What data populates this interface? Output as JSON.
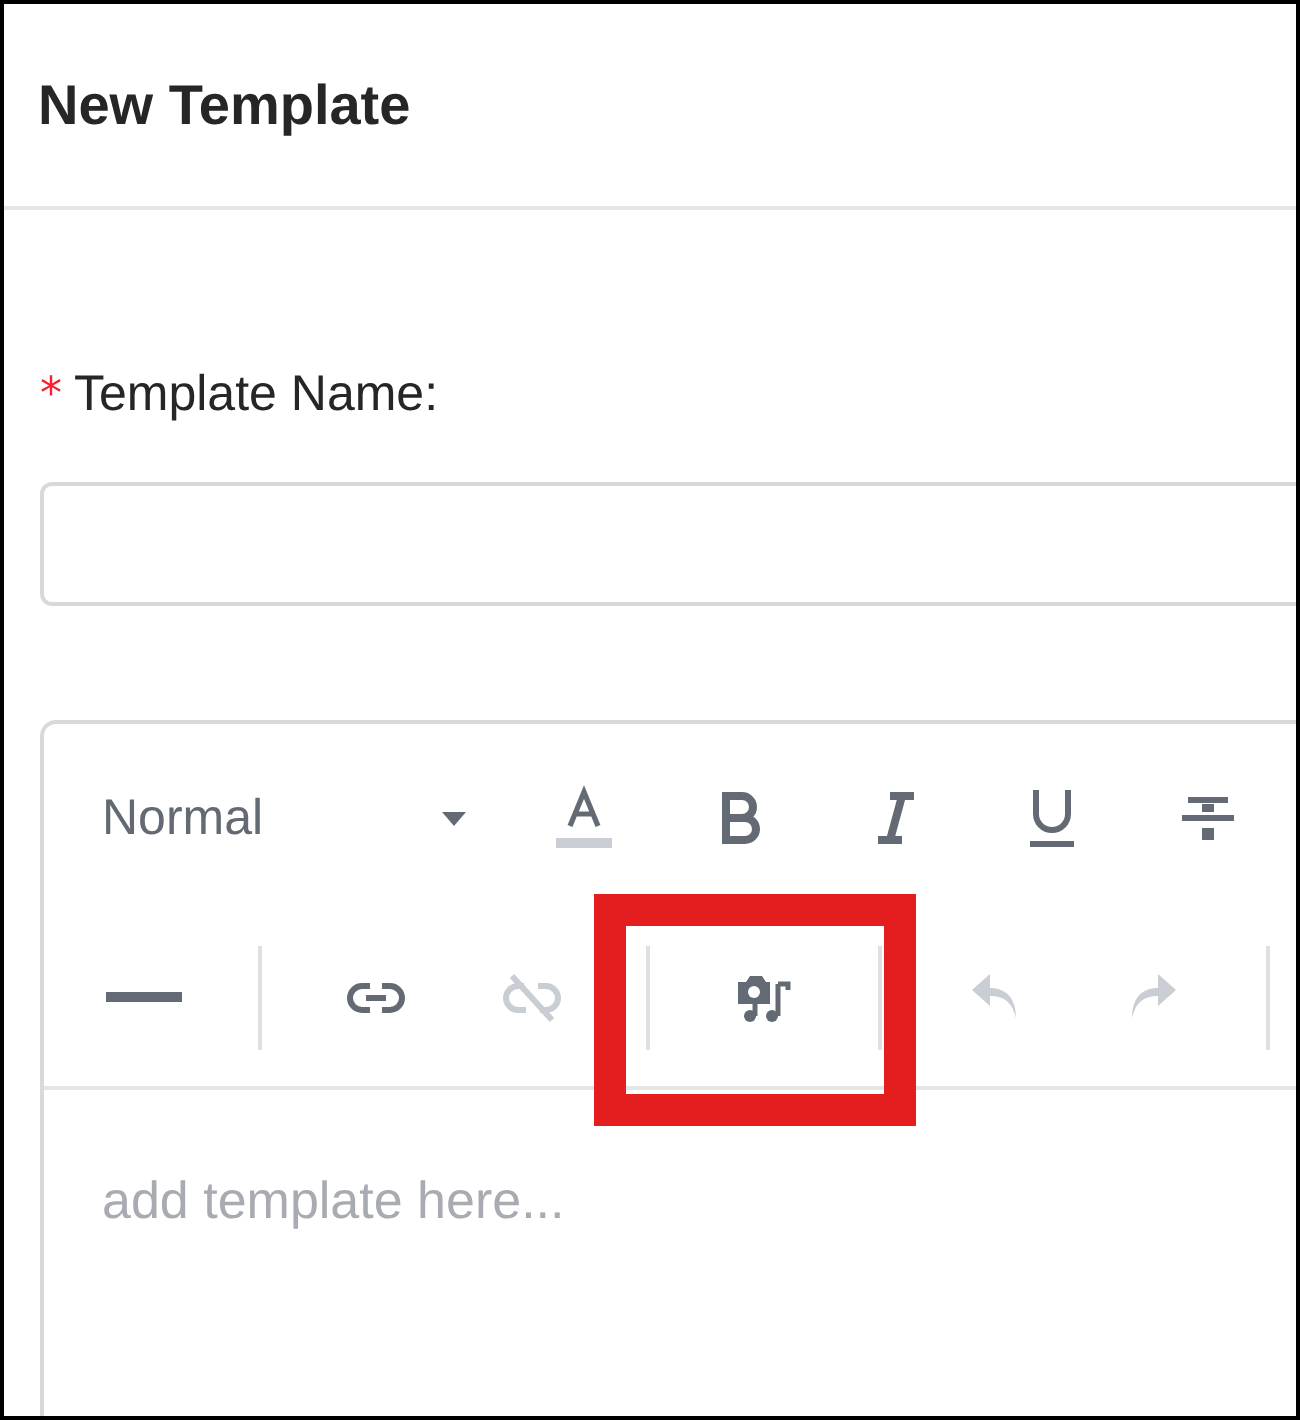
{
  "dialog": {
    "title": "New Template"
  },
  "form": {
    "field": {
      "required_mark": "*",
      "label": "Template Name:"
    },
    "editor": {
      "toolbar_rows": [
        [
          {
            "kind": "heading-select",
            "label": "Normal",
            "disabled": false
          },
          {
            "kind": "font-color",
            "disabled": false
          },
          {
            "kind": "bold",
            "disabled": false
          },
          {
            "kind": "italic",
            "disabled": false
          },
          {
            "kind": "underline",
            "disabled": false
          },
          {
            "kind": "strike",
            "disabled": false
          }
        ],
        [
          {
            "kind": "rule",
            "disabled": false
          },
          {
            "kind": "divider"
          },
          {
            "kind": "link",
            "disabled": false
          },
          {
            "kind": "unlink",
            "disabled": true
          },
          {
            "kind": "divider"
          },
          {
            "kind": "media",
            "disabled": false,
            "highlighted": true
          },
          {
            "kind": "divider"
          },
          {
            "kind": "undo",
            "disabled": true
          },
          {
            "kind": "redo",
            "disabled": true
          },
          {
            "kind": "divider"
          }
        ]
      ],
      "placeholder": "add template here..."
    }
  }
}
